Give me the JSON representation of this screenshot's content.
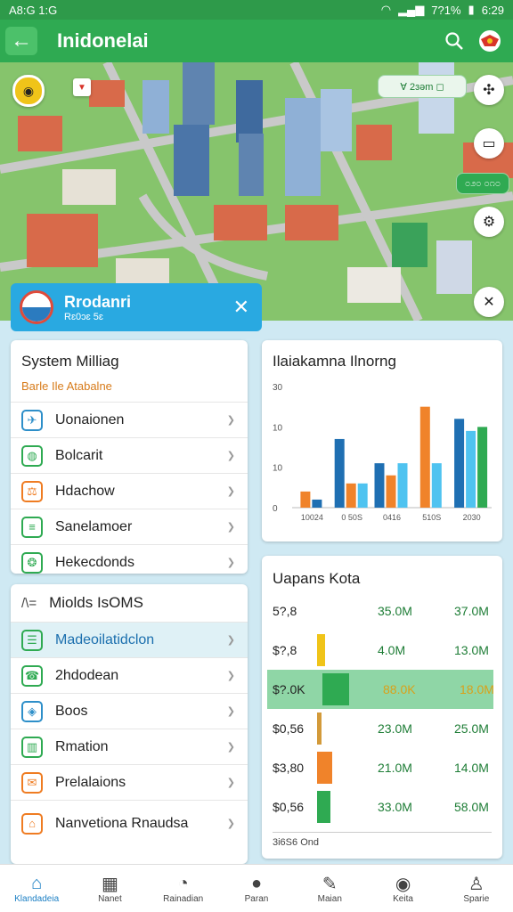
{
  "status": {
    "time_left": "A8:G 1:G",
    "battery": "7?1%",
    "time_right": "6:29"
  },
  "appbar": {
    "title": "Inidonelai"
  },
  "map": {
    "chip_label": "∀ 2ɜəm ◻",
    "chip2_label": "೦೨೦ ೦೧೦"
  },
  "promo": {
    "title": "Rrodanri",
    "subtitle": "Rɛ0ɔɛ 5ɛ"
  },
  "system": {
    "title": "System Milliag",
    "subtitle": "Barle Ile Atabalne",
    "items": [
      {
        "label": "Uonaionen",
        "icon": "plane-icon",
        "color": "#2e8fc9"
      },
      {
        "label": "Bolcarit",
        "icon": "leaf-icon",
        "color": "#2faa52"
      },
      {
        "label": "Hdachow",
        "icon": "scale-icon",
        "color": "#ef7c22"
      },
      {
        "label": "Sanelamoer",
        "icon": "doc-icon",
        "color": "#2faa52"
      },
      {
        "label": "Hekecdonds",
        "icon": "globe-icon",
        "color": "#2faa52"
      }
    ]
  },
  "modes": {
    "title": "Miolds IsOMS",
    "items": [
      {
        "label": "Madeoilatidclon",
        "icon": "list-icon",
        "color": "#2faa52"
      },
      {
        "label": "2hdodean",
        "icon": "phone-icon",
        "color": "#2faa52"
      },
      {
        "label": "Boos",
        "icon": "shield-icon",
        "color": "#2e8fc9"
      },
      {
        "label": "Rmation",
        "icon": "building-icon",
        "color": "#2faa52"
      },
      {
        "label": "Prelalaions",
        "icon": "envelope-icon",
        "color": "#ef7c22"
      },
      {
        "label": "Nanvetiona Rnaudsa",
        "icon": "temple-icon",
        "color": "#ef7c22"
      }
    ]
  },
  "chart_data": {
    "type": "bar",
    "title": "Ilaiakamna Ilnorng",
    "categories": [
      "10024",
      "0 50S",
      "0416",
      "510S",
      "2030"
    ],
    "ylim": [
      0,
      30
    ],
    "yticks": [
      "30",
      "10",
      "10",
      "0"
    ],
    "series": [
      {
        "values": [
          4,
          0,
          0,
          0,
          0
        ],
        "color": "#f0832a"
      },
      {
        "values": [
          2,
          17,
          11,
          0,
          22
        ],
        "color": "#1f6fb2"
      },
      {
        "values": [
          0,
          6,
          8,
          25,
          0
        ],
        "color": "#f0832a"
      },
      {
        "values": [
          0,
          6,
          11,
          11,
          19
        ],
        "color": "#4fc3f0"
      },
      {
        "values": [
          0,
          0,
          0,
          0,
          20
        ],
        "color": "#2faa52"
      }
    ]
  },
  "kota": {
    "title": "Uapans Kota",
    "footer": "3i6S6 Ond",
    "rows": [
      {
        "label": "5?,8",
        "a": "35.0M",
        "b": "37.0M",
        "bar_color": "",
        "bar_fill": 0
      },
      {
        "label": "$?,8",
        "a": "4.0M",
        "b": "13.0M",
        "bar_color": "#f0c419",
        "bar_fill": 0.3
      },
      {
        "label": "$?.0K",
        "a": "88.0K",
        "b": "18.0M",
        "bar_color": "#2faa52",
        "bar_fill": 1,
        "highlight": true
      },
      {
        "label": "$0,56",
        "a": "23.0M",
        "b": "25.0M",
        "bar_color": "#d39a3a",
        "bar_fill": 0.15
      },
      {
        "label": "$3,80",
        "a": "21.0M",
        "b": "14.0M",
        "bar_color": "#f0832a",
        "bar_fill": 0.55
      },
      {
        "label": "$0,56",
        "a": "33.0M",
        "b": "58.0M",
        "bar_color": "#2faa52",
        "bar_fill": 0.5
      }
    ]
  },
  "bottom": {
    "tabs": [
      {
        "label": "Klandadeia",
        "icon": "home-icon",
        "active": true
      },
      {
        "label": "Nanet",
        "icon": "grid-icon"
      },
      {
        "label": "Rainadian",
        "icon": "chat-icon"
      },
      {
        "label": "Paran",
        "icon": "compass-icon"
      },
      {
        "label": "Maian",
        "icon": "pen-icon"
      },
      {
        "label": "Keita",
        "icon": "badge-icon"
      },
      {
        "label": "Sparie",
        "icon": "user-icon"
      }
    ]
  }
}
